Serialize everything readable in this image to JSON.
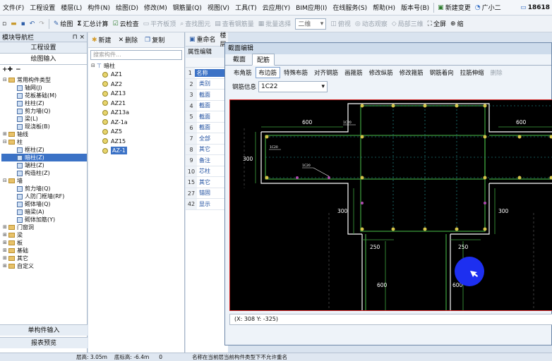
{
  "menubar": {
    "items": [
      "文件(F)",
      "工程设置",
      "楼层(L)",
      "构件(N)",
      "绘图(D)",
      "修改(M)",
      "钢筋量(Q)",
      "视图(V)",
      "工具(T)",
      "云应用(Y)",
      "BIM应用(I)",
      "在线服务(S)",
      "帮助(H)",
      "版本号(B)"
    ],
    "new_change": "新建变更",
    "assistant": "广小二",
    "phone": "18618"
  },
  "toolbar": {
    "draw": "绘图",
    "summary": "汇总计算",
    "cloud_check": "云检查",
    "flat_board": "平齐板顶",
    "find_elem": "查找图元",
    "view_rebar": "查看钢筋量",
    "batch_select": "批量选择",
    "view_mode": "二维",
    "overlook": "俯视",
    "dynamic_view": "动态观察",
    "local_3d": "局部三维",
    "fullscreen": "全屏",
    "zoom": "缩"
  },
  "left_panel": {
    "title": "模块导航栏",
    "tabs": [
      "工程设置",
      "绘图输入"
    ],
    "tree": [
      {
        "label": "常用构件类型",
        "level": 0,
        "type": "folder",
        "expanded": true
      },
      {
        "label": "轴网(J)",
        "level": 1,
        "type": "leaf"
      },
      {
        "label": "花板基础(M)",
        "level": 1,
        "type": "leaf"
      },
      {
        "label": "柱柱(Z)",
        "level": 1,
        "type": "leaf"
      },
      {
        "label": "剪力墙(Q)",
        "level": 1,
        "type": "leaf"
      },
      {
        "label": "梁(L)",
        "level": 1,
        "type": "leaf"
      },
      {
        "label": "现浇板(B)",
        "level": 1,
        "type": "leaf"
      },
      {
        "label": "轴线",
        "level": 0,
        "type": "folder",
        "expanded": false
      },
      {
        "label": "柱",
        "level": 0,
        "type": "folder",
        "expanded": true
      },
      {
        "label": "框柱(Z)",
        "level": 1,
        "type": "leaf"
      },
      {
        "label": "暗柱(Z)",
        "level": 1,
        "type": "leaf",
        "selected": true
      },
      {
        "label": "端柱(Z)",
        "level": 1,
        "type": "leaf"
      },
      {
        "label": "构造柱(Z)",
        "level": 1,
        "type": "leaf"
      },
      {
        "label": "墙",
        "level": 0,
        "type": "folder",
        "expanded": true
      },
      {
        "label": "剪力墙(Q)",
        "level": 1,
        "type": "leaf"
      },
      {
        "label": "人防门框墙(RF)",
        "level": 1,
        "type": "leaf"
      },
      {
        "label": "砌体墙(Q)",
        "level": 1,
        "type": "leaf"
      },
      {
        "label": "暗梁(A)",
        "level": 1,
        "type": "leaf"
      },
      {
        "label": "砌体加筋(Y)",
        "level": 1,
        "type": "leaf"
      },
      {
        "label": "门窗洞",
        "level": 0,
        "type": "folder",
        "expanded": false
      },
      {
        "label": "梁",
        "level": 0,
        "type": "folder",
        "expanded": false
      },
      {
        "label": "板",
        "level": 0,
        "type": "folder",
        "expanded": false
      },
      {
        "label": "基础",
        "level": 0,
        "type": "folder",
        "expanded": false
      },
      {
        "label": "其它",
        "level": 0,
        "type": "folder",
        "expanded": false
      },
      {
        "label": "自定义",
        "level": 0,
        "type": "folder",
        "expanded": false
      }
    ],
    "bottom_tabs": [
      "单构件输入",
      "报表预览"
    ]
  },
  "mid_panel": {
    "new": "新建",
    "delete": "删除",
    "copy": "复制",
    "rename": "重命名",
    "floor": "楼层",
    "search_placeholder": "搜索构件...",
    "root": "暗柱",
    "items": [
      "AZ1",
      "AZ2",
      "AZ13",
      "AZ21",
      "AZ13a",
      "AZ-1a",
      "AZ5",
      "AZ15",
      "AZ-1"
    ],
    "selected_index": 8
  },
  "props": {
    "title": "属性编辑",
    "rows": [
      {
        "num": "1",
        "name": "名称",
        "selected": true
      },
      {
        "num": "2",
        "name": "类别"
      },
      {
        "num": "3",
        "name": "截面"
      },
      {
        "num": "4",
        "name": "截面"
      },
      {
        "num": "5",
        "name": "截面"
      },
      {
        "num": "6",
        "name": "截面"
      },
      {
        "num": "7",
        "name": "全部"
      },
      {
        "num": "8",
        "name": "其它"
      },
      {
        "num": "9",
        "name": "备注"
      },
      {
        "num": "10",
        "name": "芯柱"
      },
      {
        "num": "15",
        "name": "其它"
      },
      {
        "num": "27",
        "name": "锚固"
      },
      {
        "num": "42",
        "name": "显示"
      }
    ]
  },
  "dialog": {
    "title": "截面编辑",
    "tabs": [
      "截面",
      "配筋"
    ],
    "active_tab": 1,
    "tools": [
      "布角筋",
      "布边筋",
      "特殊布筋",
      "对齐钢筋",
      "画箍筋",
      "修改纵筋",
      "修改箍筋",
      "钢筋着向",
      "拉筋伸缩",
      "删除"
    ],
    "active_tool": 1,
    "rebar_label": "钢筋信息",
    "rebar_value": "1C22",
    "status": "(X: 308 Y: -325)",
    "dims": [
      "600",
      "600",
      "300",
      "300",
      "300",
      "250",
      "250",
      "600",
      "600"
    ],
    "small_labels": [
      "1C20",
      "1C20",
      "1C20"
    ]
  },
  "statusbar": {
    "floor_height": "层高: 3.05m",
    "bottom_height": "底标高: -6.4m",
    "value": "0",
    "message": "名称在当前层当前构件类型下不允许重名"
  },
  "colors": {
    "accent": "#3b72c6",
    "canvas_bg": "#000000",
    "rebar_green": "#3fa33f",
    "cursor_blue": "#1d2ff0"
  }
}
